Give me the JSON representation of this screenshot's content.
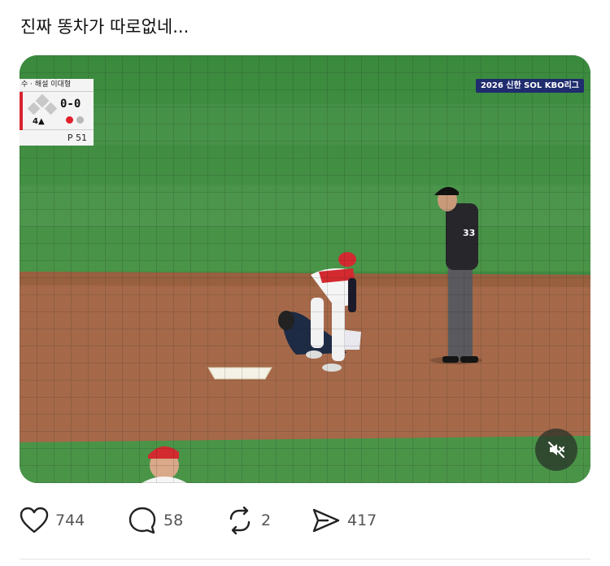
{
  "post": {
    "text": "진짜 똥차가 따로없네..."
  },
  "video": {
    "scorebug": {
      "header": "수 · 해설 이대형",
      "count": "0-0",
      "inning": "4▲",
      "pitch_count": "P  51"
    },
    "broadcast_logo": "2026 신한 SOL KBO리그",
    "mute_icon": "speaker-muted-icon"
  },
  "actions": {
    "likes": "744",
    "replies": "58",
    "reposts": "2",
    "shares": "417"
  },
  "colors": {
    "grass": "#3f8a42",
    "dirt": "#a5694a",
    "text": "#111111",
    "count_text": "#555555"
  }
}
